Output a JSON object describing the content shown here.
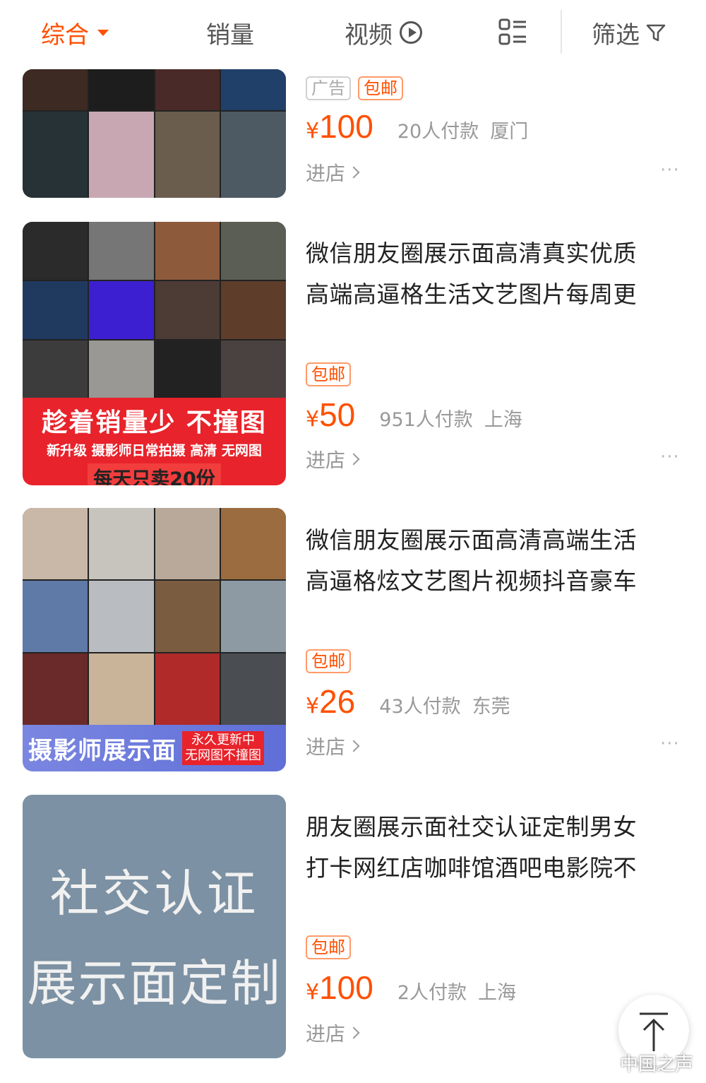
{
  "tabs": {
    "comprehensive": "综合",
    "sales": "销量",
    "video": "视频",
    "filter": "筛选"
  },
  "items": [
    {
      "tags": [
        "广告",
        "包邮"
      ],
      "yen": "¥",
      "price": "100",
      "sales": "20人付款",
      "city": "厦门",
      "shop": "进店",
      "more": "···"
    },
    {
      "title_line1": "微信朋友圈展示面高清真实优质",
      "title_line2": "高端高逼格生活文艺图片每周更",
      "tags": [
        "包邮"
      ],
      "yen": "¥",
      "price": "50",
      "sales": "951人付款",
      "city": "上海",
      "shop": "进店",
      "more": "···",
      "banner_line1": "趁着销量少 不撞图",
      "banner_line2": "新升级 摄影师日常拍摄 高清 无网图",
      "banner_line3": "每天只卖20份"
    },
    {
      "title_line1": "微信朋友圈展示面高清高端生活",
      "title_line2": "高逼格炫文艺图片视频抖音豪车",
      "tags": [
        "包邮"
      ],
      "yen": "¥",
      "price": "26",
      "sales": "43人付款",
      "city": "东莞",
      "shop": "进店",
      "more": "···",
      "banner_main": "摄影师展示面",
      "banner_side1": "永久更新中",
      "banner_side2": "无网图不撞图"
    },
    {
      "title_line1": "朋友圈展示面社交认证定制男女",
      "title_line2": "打卡网红店咖啡馆酒吧电影院不",
      "tags": [
        "包邮"
      ],
      "yen": "¥",
      "price": "100",
      "sales": "2人付款",
      "city": "上海",
      "shop": "进店",
      "card_line1": "社交认证",
      "card_line2": "展示面定制"
    }
  ],
  "watermark": "中国之声",
  "colors": {
    "accent": "#ff5000",
    "red_banner": "#e8232b",
    "gray_card": "#7c91a3"
  },
  "icons": [
    "caret-down-icon",
    "play-circle-icon",
    "layout-toggle-icon",
    "filter-funnel-icon",
    "chevron-right-icon",
    "back-to-top-icon",
    "weibo-icon"
  ]
}
